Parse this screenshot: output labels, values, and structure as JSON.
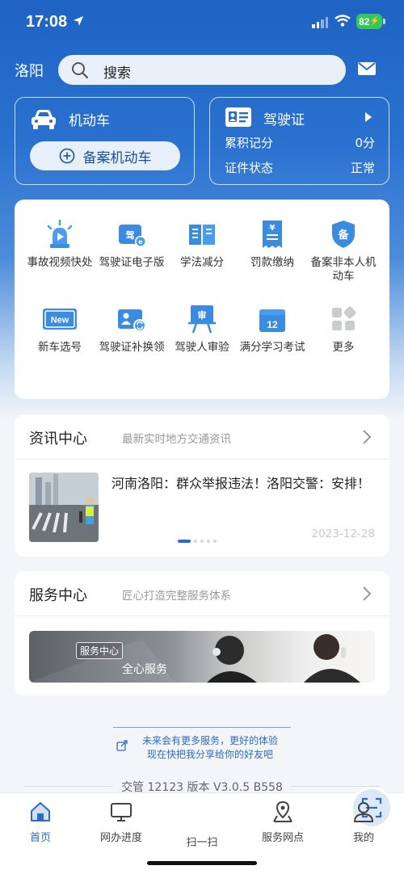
{
  "status": {
    "time": "17:08",
    "battery": "82"
  },
  "header": {
    "city": "洛阳",
    "search_placeholder": "搜索"
  },
  "vehicle_card": {
    "title": "机动车",
    "button": "备案机动车"
  },
  "license_card": {
    "title": "驾驶证",
    "rows": [
      {
        "label": "累积记分",
        "value": "0分"
      },
      {
        "label": "证件状态",
        "value": "正常"
      }
    ]
  },
  "services": [
    {
      "label": "事故视频快处",
      "icon": "siren-icon"
    },
    {
      "label": "驾驶证电子版",
      "icon": "e-license-icon"
    },
    {
      "label": "学法减分",
      "icon": "book-icon"
    },
    {
      "label": "罚款缴纳",
      "icon": "fine-receipt-icon"
    },
    {
      "label": "备案非本人机动车",
      "icon": "shield-record-icon"
    },
    {
      "label": "新车选号",
      "icon": "new-plate-icon"
    },
    {
      "label": "驾驶证补换领",
      "icon": "license-renew-icon"
    },
    {
      "label": "驾驶人审验",
      "icon": "review-board-icon"
    },
    {
      "label": "满分学习考试",
      "icon": "calendar-12-icon"
    },
    {
      "label": "更多",
      "icon": "more-grid-icon"
    }
  ],
  "news": {
    "title": "资讯中心",
    "subtitle": "最新实时地方交通资讯",
    "headline": "河南洛阳：群众举报违法！洛阳交警：安排！",
    "date": "2023-12-28"
  },
  "service_center": {
    "title": "服务中心",
    "subtitle": "匠心打造完整服务体系",
    "banner_badge": "服务中心",
    "banner_text": "全心服务"
  },
  "share": {
    "line1": "未来会有更多服务，更好的体验",
    "line2": "现在快把我分享给你的好友吧"
  },
  "version": "交管 12123 版本 V3.0.5 B558",
  "tabs": [
    "首页",
    "网办进度",
    "扫一扫",
    "服务网点",
    "我的"
  ],
  "colors": {
    "primary": "#2d6bc6",
    "hero": "#1e63c4"
  }
}
